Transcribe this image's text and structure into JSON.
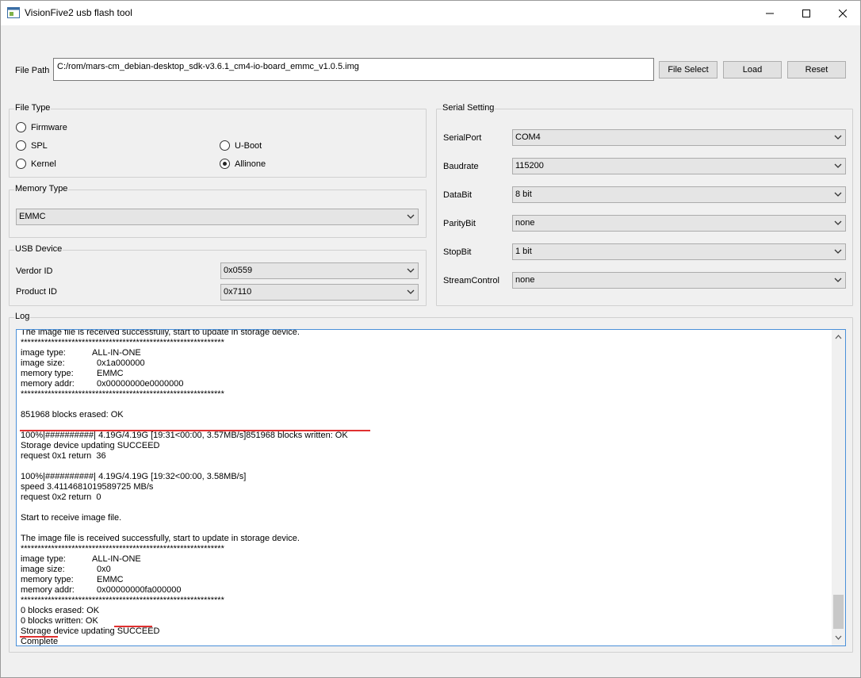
{
  "window": {
    "title": "VisionFive2 usb flash tool"
  },
  "file_path": {
    "label": "File Path",
    "value": "C:/rom/mars-cm_debian-desktop_sdk-v3.6.1_cm4-io-board_emmc_v1.0.5.img"
  },
  "buttons": {
    "file_select": "File Select",
    "load": "Load",
    "reset": "Reset"
  },
  "file_type": {
    "title": "File Type",
    "options": {
      "firmware": "Firmware",
      "spl": "SPL",
      "uboot": "U-Boot",
      "kernel": "Kernel",
      "allinone": "Allinone"
    },
    "selected": "Allinone"
  },
  "memory_type": {
    "title": "Memory Type",
    "value": "EMMC"
  },
  "usb_device": {
    "title": "USB Device",
    "vendor_label": "Verdor ID",
    "vendor_value": "0x0559",
    "product_label": "Product ID",
    "product_value": "0x7110"
  },
  "serial": {
    "title": "Serial Setting",
    "rows": [
      {
        "label": "SerialPort",
        "value": "COM4"
      },
      {
        "label": "Baudrate",
        "value": "115200"
      },
      {
        "label": "DataBit",
        "value": "8 bit"
      },
      {
        "label": "ParityBit",
        "value": "none"
      },
      {
        "label": "StopBit",
        "value": "1 bit"
      },
      {
        "label": "StreamControl",
        "value": "none"
      }
    ]
  },
  "log": {
    "title": "Log",
    "lines": [
      [
        "The image file is received successfully, start to update in storage device.",
        "",
        ""
      ],
      [
        "************************************************************",
        "",
        ""
      ],
      [
        "image type:",
        "ALL-IN-ONE",
        ""
      ],
      [
        "image size:",
        "",
        "0x1a000000"
      ],
      [
        "memory type:",
        "",
        "EMMC"
      ],
      [
        "memory addr:",
        "",
        "0x00000000e0000000"
      ],
      [
        "************************************************************",
        "",
        ""
      ],
      [
        "",
        "",
        ""
      ],
      [
        "851968 blocks erased: OK",
        "",
        ""
      ],
      [
        "",
        "",
        ""
      ],
      [
        "100%|##########| 4.19G/4.19G [19:31<00:00, 3.57MB/s]851968 blocks written: OK",
        "",
        ""
      ],
      [
        "Storage device updating SUCCEED",
        "",
        ""
      ],
      [
        "request 0x1 return  36",
        "",
        ""
      ],
      [
        "",
        "",
        ""
      ],
      [
        "100%|##########| 4.19G/4.19G [19:32<00:00, 3.58MB/s]",
        "",
        ""
      ],
      [
        "speed 3.4114681019589725 MB/s",
        "",
        ""
      ],
      [
        "request 0x2 return  0",
        "",
        ""
      ],
      [
        "",
        "",
        ""
      ],
      [
        "Start to receive image file.",
        "",
        ""
      ],
      [
        "",
        "",
        ""
      ],
      [
        "The image file is received successfully, start to update in storage device.",
        "",
        ""
      ],
      [
        "************************************************************",
        "",
        ""
      ],
      [
        "image type:",
        "ALL-IN-ONE",
        ""
      ],
      [
        "image size:",
        "",
        "0x0"
      ],
      [
        "memory type:",
        "",
        "EMMC"
      ],
      [
        "memory addr:",
        "",
        "0x00000000fa000000"
      ],
      [
        "************************************************************",
        "",
        ""
      ],
      [
        "0 blocks erased: OK",
        "",
        ""
      ],
      [
        "0 blocks written: OK",
        "",
        ""
      ],
      [
        "Storage device updating SUCCEED",
        "",
        ""
      ],
      [
        "Complete",
        "",
        ""
      ]
    ]
  },
  "colors": {
    "annotation": "#e03030",
    "focus_border": "#4a90d9"
  }
}
